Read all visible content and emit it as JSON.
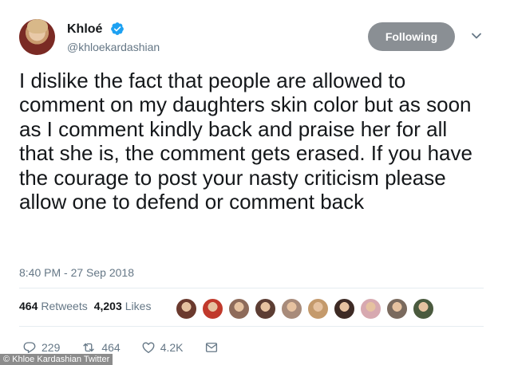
{
  "user": {
    "name": "Khloé",
    "handle": "@khloekardashian"
  },
  "follow_button": {
    "label": "Following"
  },
  "tweet": {
    "text": "I dislike the fact that people are allowed to comment on my daughters skin color but as soon as I comment kindly back and praise her for all that she is, the comment gets erased. If you have the courage to post your nasty criticism please allow one to defend or comment back",
    "timestamp": "8:40 PM - 27 Sep 2018"
  },
  "stats": {
    "retweets_count": "464",
    "retweets_label": "Retweets",
    "likes_count": "4,203",
    "likes_label": "Likes"
  },
  "liker_avatars": [
    "#6b3a2e",
    "#c0392b",
    "#8e6b5a",
    "#5c3d33",
    "#a88b7a",
    "#c49a6c",
    "#3d2a24",
    "#d7a9b0",
    "#7a6a5e",
    "#4a5a3e"
  ],
  "actions": {
    "replies": "229",
    "retweets": "464",
    "likes": "4.2K"
  },
  "watermark": "© Khloe Kardashian Twitter",
  "colors": {
    "accent": "#1da1f2",
    "muted": "#657786",
    "follow_bg": "#8a8f94"
  }
}
